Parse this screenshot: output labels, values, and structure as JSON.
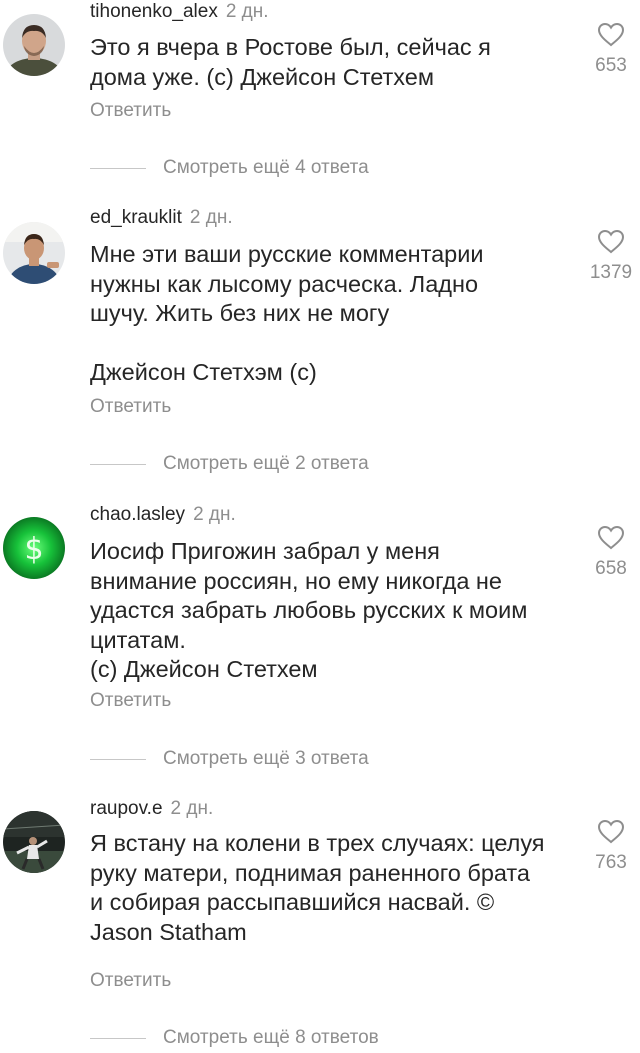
{
  "comments": [
    {
      "username": "tihonenko_alex",
      "time": "2 дн.",
      "text": [
        "Это я вчера в Ростове был, сейчас я",
        "дома уже. (с) Джейсон Стетхем"
      ],
      "reply_label": "Ответить",
      "likes": "653",
      "view_more": "Смотреть ещё 4 ответа"
    },
    {
      "username": "ed_krauklit",
      "time": "2 дн.",
      "text": [
        "Мне эти ваши русские комментарии",
        "нужны как лысому расческа. Ладно",
        "шучу. Жить без них не могу",
        "",
        "Джейсон Стетхэм (с)"
      ],
      "reply_label": "Ответить",
      "likes": "1379",
      "view_more": "Смотреть ещё 2 ответа"
    },
    {
      "username": "chao.lasley",
      "time": "2 дн.",
      "text": [
        "Иосиф Пригожин забрал у меня",
        "внимание россиян, но ему никогда не",
        "удастся забрать любовь русских к моим",
        "цитатам.",
        "(с) Джейсон Стетхем"
      ],
      "reply_label": "Ответить",
      "likes": "658",
      "view_more": "Смотреть ещё 3 ответа"
    },
    {
      "username": "raupov.e",
      "time": "2 дн.",
      "text": [
        "Я встану на колени в трех случаях: целуя",
        "руку матери, поднимая раненного брата",
        "и собирая рассыпавшийся насвай. ©",
        "Jason Statham"
      ],
      "reply_label": "Ответить",
      "likes": "763",
      "view_more": "Смотреть ещё 8 ответов"
    }
  ],
  "colors": {
    "text": "#262626",
    "secondary": "#8e8e8e",
    "divider": "#c7c7c7",
    "dollar_avatar": "#17c23a"
  }
}
